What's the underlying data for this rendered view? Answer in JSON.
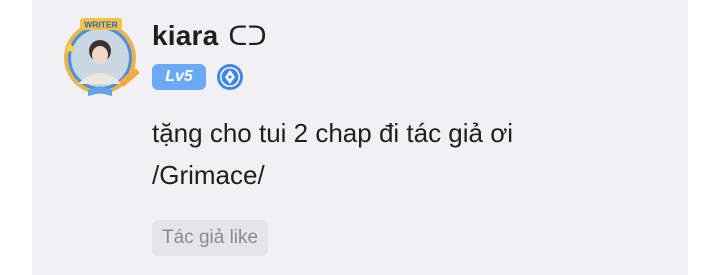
{
  "comment": {
    "user": {
      "name": "kiara",
      "name_glyph": "ᑕᑐ",
      "level": "Lv5",
      "avatar_frame_label": "WRITER",
      "badge_icon": "pen-nib-icon"
    },
    "text": "tặng cho tui 2 chap đi tác giả ơi /Grimace/",
    "tag": "Tác giả like"
  },
  "colors": {
    "card_bg": "#f1f1f3",
    "level_badge": "#6aa9f5",
    "pen_badge": "#3f86e6",
    "tag_bg": "#e5e5e8",
    "tag_text": "#8b8b8f"
  }
}
